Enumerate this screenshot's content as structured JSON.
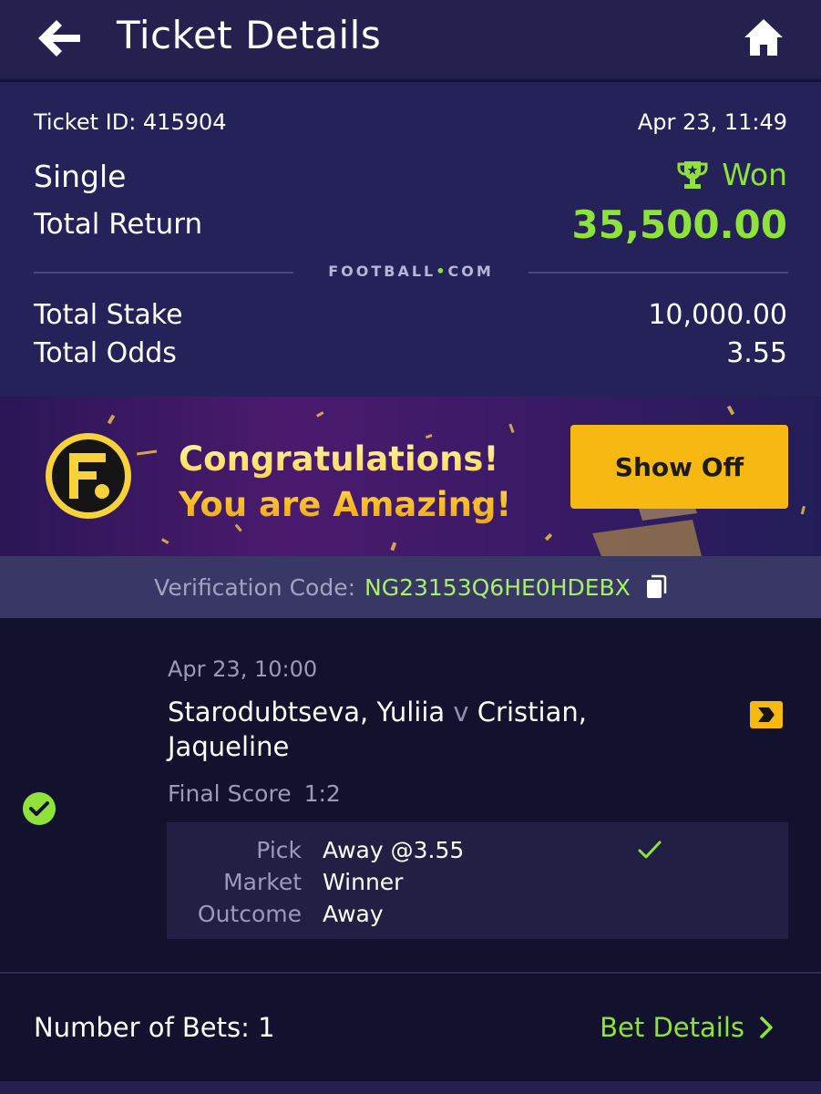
{
  "header": {
    "title": "Ticket Details",
    "back_icon": "arrow-left-icon",
    "home_icon": "home-icon"
  },
  "summary": {
    "ticket_id": "Ticket ID: 415904",
    "date": "Apr 23, 11:49",
    "bet_type": "Single",
    "status": "Won",
    "status_icon": "trophy-icon",
    "total_return_label": "Total Return",
    "total_return_value": "35,500.00",
    "brand_left": "FOOTBALL",
    "brand_dot": "•",
    "brand_right": "COM",
    "total_stake_label": "Total Stake",
    "total_stake_value": "10,000.00",
    "total_odds_label": "Total Odds",
    "total_odds_value": "3.55"
  },
  "banner": {
    "line1": "Congratulations!",
    "line2": "You are Amazing!",
    "button": "Show Off",
    "logo_letter": "F."
  },
  "verification": {
    "label": "Verification Code:",
    "code": "NG23153Q6HE0HDEBX"
  },
  "selection": {
    "date": "Apr 23, 10:00",
    "home": "Starodubtseva, Yuliia",
    "vs": "v",
    "away": "Cristian, Jaqueline",
    "final_score_label": "Final Score",
    "final_score": "1:2",
    "pick_label": "Pick",
    "pick_value": "Away @3.55",
    "market_label": "Market",
    "market_value": "Winner",
    "outcome_label": "Outcome",
    "outcome_value": "Away"
  },
  "footer": {
    "num_bets": "Number of Bets: 1",
    "bet_details": "Bet Details"
  },
  "colors": {
    "accent_green": "#8fe23a",
    "header_bg": "#24214f",
    "summary_bg": "#25225a",
    "button_yellow": "#f6b811"
  }
}
